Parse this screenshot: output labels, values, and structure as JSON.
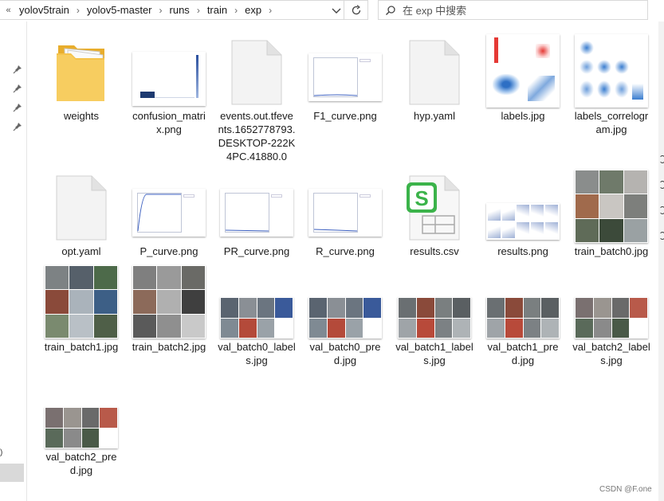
{
  "breadcrumb": {
    "prefix_glyph": "«",
    "items": [
      "yolov5train",
      "yolov5-master",
      "runs",
      "train",
      "exp"
    ],
    "separator": "›"
  },
  "search": {
    "placeholder": "在 exp 中搜索"
  },
  "nav": {
    "partial_label": ")"
  },
  "files": [
    {
      "name": "weights",
      "icon": "folder-icon"
    },
    {
      "name": "confusion_matrix.png",
      "icon": "image-icon"
    },
    {
      "name": "events.out.tfevents.1652778793.DESKTOP-222K4PC.41880.0",
      "icon": "blank-file-icon"
    },
    {
      "name": "F1_curve.png",
      "icon": "image-icon"
    },
    {
      "name": "hyp.yaml",
      "icon": "blank-file-icon"
    },
    {
      "name": "labels.jpg",
      "icon": "image-icon"
    },
    {
      "name": "labels_correlogram.jpg",
      "icon": "image-icon"
    },
    {
      "name": "opt.yaml",
      "icon": "blank-file-icon"
    },
    {
      "name": "P_curve.png",
      "icon": "image-icon"
    },
    {
      "name": "PR_curve.png",
      "icon": "image-icon"
    },
    {
      "name": "R_curve.png",
      "icon": "image-icon"
    },
    {
      "name": "results.csv",
      "icon": "csv-file-icon"
    },
    {
      "name": "results.png",
      "icon": "image-icon"
    },
    {
      "name": "train_batch0.jpg",
      "icon": "image-icon"
    },
    {
      "name": "train_batch1.jpg",
      "icon": "image-icon"
    },
    {
      "name": "train_batch2.jpg",
      "icon": "image-icon"
    },
    {
      "name": "val_batch0_labels.jpg",
      "icon": "image-icon"
    },
    {
      "name": "val_batch0_pred.jpg",
      "icon": "image-icon"
    },
    {
      "name": "val_batch1_labels.jpg",
      "icon": "image-icon"
    },
    {
      "name": "val_batch1_pred.jpg",
      "icon": "image-icon"
    },
    {
      "name": "val_batch2_labels.jpg",
      "icon": "image-icon"
    },
    {
      "name": "val_batch2_pred.jpg",
      "icon": "image-icon"
    }
  ],
  "colors": {
    "folder": "#f5c34a",
    "csv_green": "#3bb34a",
    "plot_blue": "#3b5fc0",
    "selection": "#d9d9d9"
  },
  "watermark": "CSDN @F.one"
}
